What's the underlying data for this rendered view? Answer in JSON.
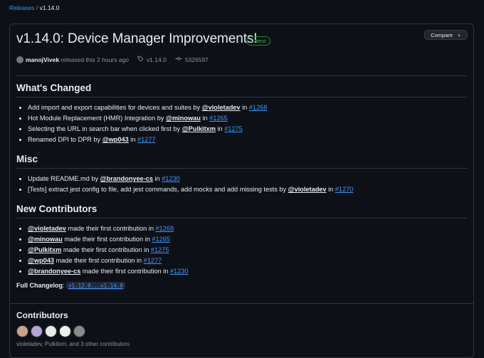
{
  "breadcrumb": {
    "releases": "Releases",
    "separator": "/",
    "current": "v1.14.0"
  },
  "release": {
    "title": "v1.14.0: Device Manager Improvements!",
    "badge": "Latest",
    "compare_label": "Compare",
    "author": "manojVivek",
    "released_text": "released this 2 hours ago",
    "tag": "v1.14.0",
    "commit": "5326597"
  },
  "sections": {
    "whats_changed": {
      "title": "What's Changed",
      "items": [
        {
          "text": "Add import and export capabilities for devices and suites by ",
          "user": "@violetadev",
          "in": " in ",
          "pr": "#1268"
        },
        {
          "text": "Hot Module Replacement (HMR) Integration by ",
          "user": "@minowau",
          "in": " in ",
          "pr": "#1265"
        },
        {
          "text": "Selecting the URL in search bar when clicked first by ",
          "user": "@Pulkitxm",
          "in": " in ",
          "pr": "#1275"
        },
        {
          "text": "Renamed DPI to DPR by ",
          "user": "@wp043",
          "in": " in ",
          "pr": "#1277"
        }
      ]
    },
    "misc": {
      "title": "Misc",
      "items": [
        {
          "text": "Update README.md by ",
          "user": "@brandonyee-cs",
          "in": " in ",
          "pr": "#1230"
        },
        {
          "text": "[Tests] extract jest config to file, add jest commands, add mocks and add missing tests by ",
          "user": "@violetadev",
          "in": " in ",
          "pr": "#1270"
        }
      ]
    },
    "new_contributors": {
      "title": "New Contributors",
      "items": [
        {
          "user": "@violetadev",
          "text": " made their first contribution in ",
          "pr": "#1268"
        },
        {
          "user": "@minowau",
          "text": " made their first contribution in ",
          "pr": "#1265"
        },
        {
          "user": "@Pulkitxm",
          "text": " made their first contribution in ",
          "pr": "#1275"
        },
        {
          "user": "@wp043",
          "text": " made their first contribution in ",
          "pr": "#1277"
        },
        {
          "user": "@brandonyee-cs",
          "text": " made their first contribution in ",
          "pr": "#1230"
        }
      ]
    }
  },
  "changelog": {
    "label": "Full Changelog",
    "colon": ": ",
    "range": "v1.12.0...v1.14.0"
  },
  "contributors": {
    "title": "Contributors",
    "names": "violetadev, Pulkitxm, and 3 other contributors",
    "avatar_colors": [
      "#c9a48a",
      "#b6a3d8",
      "#eaeaea",
      "#f0f0f0",
      "#8a8a8a"
    ]
  },
  "icons": {
    "tag": "tag-icon",
    "commit": "commit-icon",
    "caret": "triangle-down-icon"
  }
}
